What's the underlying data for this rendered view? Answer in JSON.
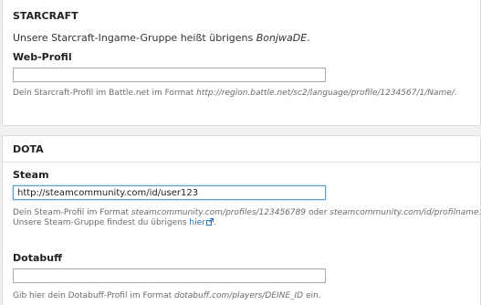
{
  "starcraft": {
    "title": "STARCRAFT",
    "intro_prefix": "Unsere Starcraft-Ingame-Gruppe heißt übrigens ",
    "intro_group": "BonjwaDE",
    "intro_suffix": ".",
    "web_profile": {
      "label": "Web-Profil",
      "value": "",
      "help_prefix": "Dein Starcraft-Profil im Battle.net im Format ",
      "help_format": "http://region.battle.net/sc2/language/profile/1234567/1/Name/",
      "help_suffix": "."
    }
  },
  "dota": {
    "title": "DOTA",
    "steam": {
      "label": "Steam",
      "value": "http://steamcommunity.com/id/user123",
      "help_line1_prefix": "Dein Steam-Profil im Format ",
      "help_format1": "steamcommunity.com/profiles/123456789",
      "help_or": " oder ",
      "help_format2": "steamcommunity.com/id/profilname",
      "help_line1_suffix": ".",
      "help_line2_prefix": "Unsere Steam-Gruppe findest du übrigens ",
      "help_link": "hier",
      "help_line2_suffix": "."
    },
    "dotabuff": {
      "label": "Dotabuff",
      "value": "",
      "help_prefix": "Gib hier dein Dotabuff-Profil im Format ",
      "help_format": "dotabuff.com/players/DEINE_ID",
      "help_suffix": " ein."
    }
  },
  "icons": {
    "external_link": "external-link-icon"
  },
  "colors": {
    "link": "#2a6fb0",
    "focus_border": "#5e9ed6"
  }
}
